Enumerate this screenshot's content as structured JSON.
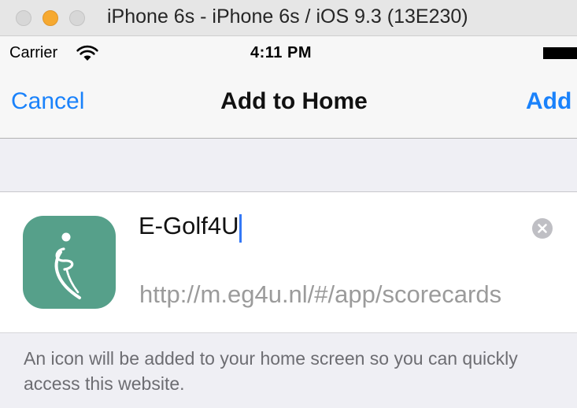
{
  "window": {
    "title": "iPhone 6s - iPhone 6s / iOS 9.3 (13E230)"
  },
  "status_bar": {
    "carrier": "Carrier",
    "time": "4:11 PM",
    "icons": [
      "wifi-icon",
      "battery-icon"
    ]
  },
  "nav": {
    "cancel_label": "Cancel",
    "title": "Add to Home",
    "add_label": "Add"
  },
  "bookmark": {
    "name_value": "E-Golf4U",
    "url": "http://m.eg4u.nl/#/app/scorecards",
    "icon": "app-icon",
    "icon_color": "#56a08a"
  },
  "footer": {
    "note": "An icon will be added to your home screen so you can quickly access this website."
  },
  "colors": {
    "accent": "#1a82fb",
    "caret": "#3478f6"
  }
}
